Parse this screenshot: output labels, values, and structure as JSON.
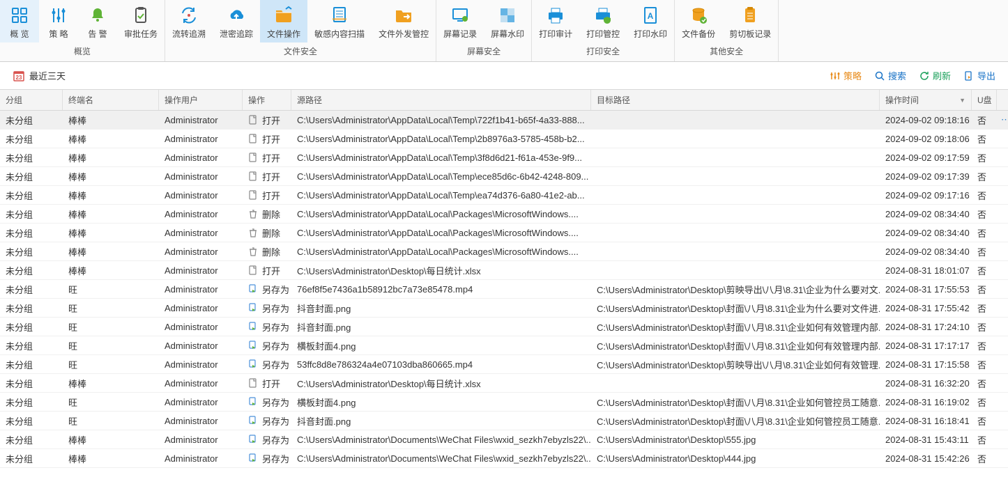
{
  "ribbon": {
    "groups": [
      {
        "label": "概览",
        "items": [
          {
            "id": "overview",
            "label": "概 览",
            "icon": "grid"
          },
          {
            "id": "policy",
            "label": "策 略",
            "icon": "sliders"
          },
          {
            "id": "alert",
            "label": "告 警",
            "icon": "bell"
          },
          {
            "id": "approve",
            "label": "审批任务",
            "icon": "clipboard"
          }
        ]
      },
      {
        "label": "文件安全",
        "items": [
          {
            "id": "trace",
            "label": "流转追溯",
            "icon": "cycle"
          },
          {
            "id": "leak",
            "label": "泄密追踪",
            "icon": "cloud-up"
          },
          {
            "id": "fileop",
            "label": "文件操作",
            "icon": "folder",
            "active": true
          },
          {
            "id": "sensitive",
            "label": "敏感内容扫描",
            "icon": "scan"
          },
          {
            "id": "outgoing",
            "label": "文件外发管控",
            "icon": "folder-out"
          }
        ]
      },
      {
        "label": "屏幕安全",
        "items": [
          {
            "id": "screenrec",
            "label": "屏幕记录",
            "icon": "screen"
          },
          {
            "id": "screenwm",
            "label": "屏幕水印",
            "icon": "watermark"
          }
        ]
      },
      {
        "label": "打印安全",
        "items": [
          {
            "id": "printaudit",
            "label": "打印审计",
            "icon": "printer"
          },
          {
            "id": "printctrl",
            "label": "打印管控",
            "icon": "printer-shield"
          },
          {
            "id": "printwm",
            "label": "打印水印",
            "icon": "doc-a"
          }
        ]
      },
      {
        "label": "其他安全",
        "items": [
          {
            "id": "backup",
            "label": "文件备份",
            "icon": "db"
          },
          {
            "id": "clip",
            "label": "剪切板记录",
            "icon": "clipboard2"
          }
        ]
      }
    ]
  },
  "dateFilter": "最近三天",
  "toolbar": {
    "policy": "策略",
    "search": "搜索",
    "refresh": "刷新",
    "export": "导出"
  },
  "columns": {
    "group": "分组",
    "terminal": "终端名",
    "user": "操作用户",
    "op": "操作",
    "src": "源路径",
    "dst": "目标路径",
    "time": "操作时间",
    "usb": "U盘"
  },
  "rows": [
    {
      "group": "未分组",
      "terminal": "棒棒",
      "user": "Administrator",
      "op": "打开",
      "opType": "open",
      "src": "C:\\Users\\Administrator\\AppData\\Local\\Temp\\722f1b41-b65f-4a33-888...",
      "dst": "",
      "time": "2024-09-02 09:18:16",
      "usb": "否",
      "hl": true
    },
    {
      "group": "未分组",
      "terminal": "棒棒",
      "user": "Administrator",
      "op": "打开",
      "opType": "open",
      "src": "C:\\Users\\Administrator\\AppData\\Local\\Temp\\2b8976a3-5785-458b-b2...",
      "dst": "",
      "time": "2024-09-02 09:18:06",
      "usb": "否"
    },
    {
      "group": "未分组",
      "terminal": "棒棒",
      "user": "Administrator",
      "op": "打开",
      "opType": "open",
      "src": "C:\\Users\\Administrator\\AppData\\Local\\Temp\\3f8d6d21-f61a-453e-9f9...",
      "dst": "",
      "time": "2024-09-02 09:17:59",
      "usb": "否"
    },
    {
      "group": "未分组",
      "terminal": "棒棒",
      "user": "Administrator",
      "op": "打开",
      "opType": "open",
      "src": "C:\\Users\\Administrator\\AppData\\Local\\Temp\\ece85d6c-6b42-4248-809...",
      "dst": "",
      "time": "2024-09-02 09:17:39",
      "usb": "否"
    },
    {
      "group": "未分组",
      "terminal": "棒棒",
      "user": "Administrator",
      "op": "打开",
      "opType": "open",
      "src": "C:\\Users\\Administrator\\AppData\\Local\\Temp\\ea74d376-6a80-41e2-ab...",
      "dst": "",
      "time": "2024-09-02 09:17:16",
      "usb": "否"
    },
    {
      "group": "未分组",
      "terminal": "棒棒",
      "user": "Administrator",
      "op": "删除",
      "opType": "delete",
      "src": "C:\\Users\\Administrator\\AppData\\Local\\Packages\\MicrosoftWindows....",
      "dst": "",
      "time": "2024-09-02 08:34:40",
      "usb": "否"
    },
    {
      "group": "未分组",
      "terminal": "棒棒",
      "user": "Administrator",
      "op": "删除",
      "opType": "delete",
      "src": "C:\\Users\\Administrator\\AppData\\Local\\Packages\\MicrosoftWindows....",
      "dst": "",
      "time": "2024-09-02 08:34:40",
      "usb": "否"
    },
    {
      "group": "未分组",
      "terminal": "棒棒",
      "user": "Administrator",
      "op": "删除",
      "opType": "delete",
      "src": "C:\\Users\\Administrator\\AppData\\Local\\Packages\\MicrosoftWindows....",
      "dst": "",
      "time": "2024-09-02 08:34:40",
      "usb": "否"
    },
    {
      "group": "未分组",
      "terminal": "棒棒",
      "user": "Administrator",
      "op": "打开",
      "opType": "open",
      "src": "C:\\Users\\Administrator\\Desktop\\每日统计.xlsx",
      "dst": "",
      "time": "2024-08-31 18:01:07",
      "usb": "否"
    },
    {
      "group": "未分组",
      "terminal": "旺",
      "user": "Administrator",
      "op": "另存为",
      "opType": "saveas",
      "src": "76ef8f5e7436a1b58912bc7a73e85478.mp4",
      "dst": "C:\\Users\\Administrator\\Desktop\\剪映导出\\八月\\8.31\\企业为什么要对文...",
      "time": "2024-08-31 17:55:53",
      "usb": "否"
    },
    {
      "group": "未分组",
      "terminal": "旺",
      "user": "Administrator",
      "op": "另存为",
      "opType": "saveas",
      "src": "抖音封面.png",
      "dst": "C:\\Users\\Administrator\\Desktop\\封面\\八月\\8.31\\企业为什么要对文件进...",
      "time": "2024-08-31 17:55:42",
      "usb": "否"
    },
    {
      "group": "未分组",
      "terminal": "旺",
      "user": "Administrator",
      "op": "另存为",
      "opType": "saveas",
      "src": "抖音封面.png",
      "dst": "C:\\Users\\Administrator\\Desktop\\封面\\八月\\8.31\\企业如何有效管理内部...",
      "time": "2024-08-31 17:24:10",
      "usb": "否"
    },
    {
      "group": "未分组",
      "terminal": "旺",
      "user": "Administrator",
      "op": "另存为",
      "opType": "saveas",
      "src": "横板封面4.png",
      "dst": "C:\\Users\\Administrator\\Desktop\\封面\\八月\\8.31\\企业如何有效管理内部...",
      "time": "2024-08-31 17:17:17",
      "usb": "否"
    },
    {
      "group": "未分组",
      "terminal": "旺",
      "user": "Administrator",
      "op": "另存为",
      "opType": "saveas",
      "src": "53ffc8d8e786324a4e07103dba860665.mp4",
      "dst": "C:\\Users\\Administrator\\Desktop\\剪映导出\\八月\\8.31\\企业如何有效管理...",
      "time": "2024-08-31 17:15:58",
      "usb": "否"
    },
    {
      "group": "未分组",
      "terminal": "棒棒",
      "user": "Administrator",
      "op": "打开",
      "opType": "open",
      "src": "C:\\Users\\Administrator\\Desktop\\每日统计.xlsx",
      "dst": "",
      "time": "2024-08-31 16:32:20",
      "usb": "否"
    },
    {
      "group": "未分组",
      "terminal": "旺",
      "user": "Administrator",
      "op": "另存为",
      "opType": "saveas",
      "src": "横板封面4.png",
      "dst": "C:\\Users\\Administrator\\Desktop\\封面\\八月\\8.31\\企业如何管控员工随意...",
      "time": "2024-08-31 16:19:02",
      "usb": "否"
    },
    {
      "group": "未分组",
      "terminal": "旺",
      "user": "Administrator",
      "op": "另存为",
      "opType": "saveas",
      "src": "抖音封面.png",
      "dst": "C:\\Users\\Administrator\\Desktop\\封面\\八月\\8.31\\企业如何管控员工随意...",
      "time": "2024-08-31 16:18:41",
      "usb": "否"
    },
    {
      "group": "未分组",
      "terminal": "棒棒",
      "user": "Administrator",
      "op": "另存为",
      "opType": "saveas",
      "src": "C:\\Users\\Administrator\\Documents\\WeChat Files\\wxid_sezkh7ebyzls22\\...",
      "dst": "C:\\Users\\Administrator\\Desktop\\555.jpg",
      "time": "2024-08-31 15:43:11",
      "usb": "否"
    },
    {
      "group": "未分组",
      "terminal": "棒棒",
      "user": "Administrator",
      "op": "另存为",
      "opType": "saveas",
      "src": "C:\\Users\\Administrator\\Documents\\WeChat Files\\wxid_sezkh7ebyzls22\\...",
      "dst": "C:\\Users\\Administrator\\Desktop\\444.jpg",
      "time": "2024-08-31 15:42:26",
      "usb": "否"
    }
  ]
}
